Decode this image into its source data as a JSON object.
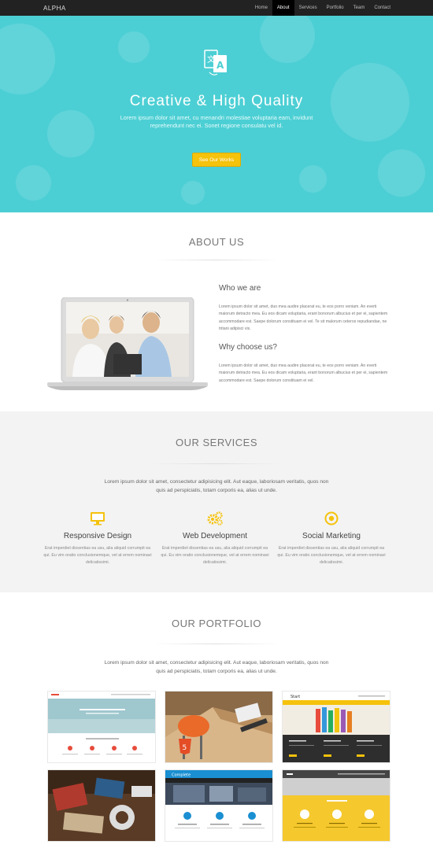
{
  "nav": {
    "brand": "ALPHA",
    "items": [
      {
        "label": "Home",
        "active": false
      },
      {
        "label": "About",
        "active": true
      },
      {
        "label": "Services",
        "active": false
      },
      {
        "label": "Portfolio",
        "active": false
      },
      {
        "label": "Team",
        "active": false
      },
      {
        "label": "Contact",
        "active": false
      }
    ]
  },
  "hero": {
    "title": "Creative & High Quality",
    "text": "Lorem ipsum dolor sit amet, cu menandri molestiae voluptaria eam, invidunt reprehendunt nec ei. Sonet regione consulatu vel id.",
    "button": "See Our Works",
    "icon": "translate-icon"
  },
  "about": {
    "title": "ABOUT US",
    "who_heading": "Who we are",
    "who_text": "Lorem ipsum dolor sit amet, duo mea audire placerat eu, te eos porro veniam. An everti maiorum detracto mea. Eu eos dicam voluptaria, erant bonorum albucius et per ei, sapientem accommodare est. Saepe dolorum constituam ei vel. Te sit malorum ceteros repudiandae, ne tritani adipisci vis.",
    "why_heading": "Why choose us?",
    "why_text": "Lorem ipsum dolor sit amet, duo mea audire placerat eu, te eos porro veniam. An everti maiorum detracto mea. Eu eos dicam voluptaria, erant bonorum albucius et per ei, sapientem accommodare est. Saepe dolorum constituam ei vel."
  },
  "services": {
    "title": "OUR SERVICES",
    "intro": "Lorem ipsum dolor sit amet, consectetur adipisicing elit. Aut eaque, laboriosam veritatis, quos non quis ad perspiciatis, totam corporis ea, alias ut unde.",
    "items": [
      {
        "title": "Responsive Design",
        "text": "Erat imperdiet dissentias ea usu, alia aliquid corrumpit ea qui. Eu vim oratio conclusionemque, vel at errem nominavi delicatissimi.",
        "icon": "monitor-icon"
      },
      {
        "title": "Web Development",
        "text": "Erat imperdiet dissentias ea usu, alia aliquid corrumpit ea qui. Eu vim oratio conclusionemque, vel at errem nominavi delicatissimi.",
        "icon": "gears-icon"
      },
      {
        "title": "Social Marketing",
        "text": "Erat imperdiet dissentias ea usu, alia aliquid corrumpit ea qui. Eu vim oratio conclusionemque, vel at errem nominavi delicatissimi.",
        "icon": "target-icon"
      }
    ]
  },
  "portfolio": {
    "title": "OUR PORTFOLIO",
    "intro": "Lorem ipsum dolor sit amet, consectetur adipisicing elit. Aut eaque, laboriosam veritatis, quos non quis ad perspiciatis, totam corporis ea, alias ut unde.",
    "thumb_texts": {
      "start": "Start",
      "complete": "Complete",
      "html": "5"
    }
  },
  "colors": {
    "hero": "#4ccfd4",
    "accent": "#f5c20c",
    "nav": "#222222"
  }
}
